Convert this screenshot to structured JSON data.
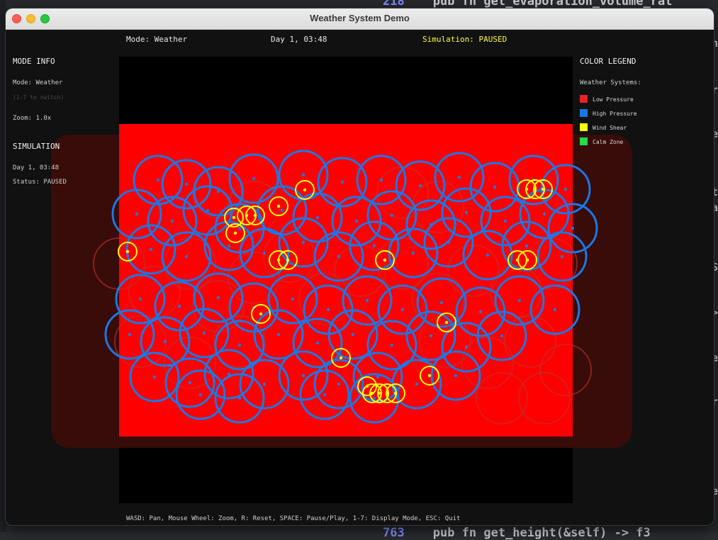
{
  "background_editor": {
    "lines": [
      {
        "num": "218",
        "code": "pub fn get_evaporation_volume_rat"
      },
      {
        "num": "763",
        "code": "pub fn get_height(&self) -> f3"
      }
    ],
    "edge_fragments": [
      "h",
      "r",
      "e",
      "t",
      "a",
      "S",
      ">",
      "e",
      "r",
      "e"
    ]
  },
  "window": {
    "title": "Weather System Demo"
  },
  "topbar": {
    "mode": "Mode: Weather",
    "time": "Day 1, 03:48",
    "simulation": "Simulation: PAUSED"
  },
  "mode_info": {
    "heading": "MODE INFO",
    "mode": "Mode: Weather",
    "hint": "(1-7 to switch)",
    "zoom": "Zoom: 1.0x"
  },
  "simulation_panel": {
    "heading": "SIMULATION",
    "time": "Day 1, 03:48",
    "status": "Status: PAUSED"
  },
  "legend": {
    "heading": "COLOR LEGEND",
    "subheading": "Weather Systems:",
    "items": [
      {
        "label": "Low Pressure",
        "color": "#e8222b"
      },
      {
        "label": "High Pressure",
        "color": "#1a78e6"
      },
      {
        "label": "Wind Shear",
        "color": "#ffff00"
      },
      {
        "label": "Calm Zone",
        "color": "#22dd44"
      }
    ]
  },
  "help_text": "WASD: Pan, Mouse Wheel: Zoom, R: Reset, SPACE: Pause/Play, 1-7: Display Mode, ESC: Quit",
  "colors": {
    "low_pressure_field": "#ff0000",
    "low_pressure_outer": "#3a0d0a",
    "high_pressure_ring": "#1a78e6",
    "wind_shear_ring": "#ffff00",
    "low_pressure_ring": "#c03030"
  }
}
